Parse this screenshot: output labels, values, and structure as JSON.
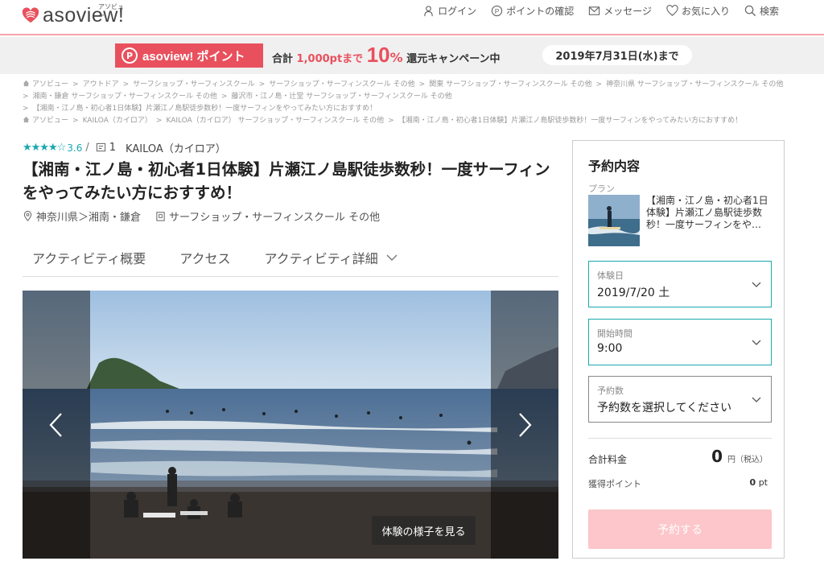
{
  "header": {
    "logo_text": "asoview!",
    "logo_sub": "アソビュー",
    "nav": [
      {
        "label": "ログイン"
      },
      {
        "label": "ポイントの確認"
      },
      {
        "label": "メッセージ"
      },
      {
        "label": "お気に入り"
      },
      {
        "label": "検索"
      }
    ]
  },
  "banner": {
    "badge_p": "P",
    "badge_name": "asoview! ポイント",
    "prefix": "合計",
    "amount": "1,000ptまで",
    "percent": "10",
    "percent_unit": "%",
    "suffix": "還元キャンペーン中",
    "date": "2019年7月31日(水)まで"
  },
  "breadcrumbs": {
    "line1": [
      "アソビュー",
      "アウトドア",
      "サーフショップ・サーフィンスクール",
      "サーフショップ・サーフィンスクール その他",
      "関東 サーフショップ・サーフィンスクール その他",
      "神奈川県 サーフショップ・サーフィンスクール その他"
    ],
    "line2": [
      "湘南・鎌倉 サーフショップ・サーフィンスクール その他",
      "藤沢市・江ノ島・辻堂 サーフショップ・サーフィンスクール その他"
    ],
    "line3": [
      "【湘南・江ノ島・初心者1日体験】片瀬江ノ島駅徒歩数秒！一度サーフィンをやってみたい方におすすめ！"
    ],
    "line4": [
      "アソビュー",
      "KAILOA（カイロア）",
      "KAILOA（カイロア） サーフショップ・サーフィンスクール その他",
      "【湘南・江ノ島・初心者1日体験】片瀬江ノ島駅徒歩数秒！一度サーフィンをやってみたい方におすすめ！"
    ]
  },
  "activity": {
    "stars": "★★★★☆",
    "score": "3.6",
    "slash": "/",
    "review_count": "1",
    "shop_name": "KAILOA（カイロア）",
    "title": "【湘南・江ノ島・初心者1日体験】片瀬江ノ島駅徒歩数秒！一度サーフィンをやってみたい方におすすめ！",
    "location": "神奈川県＞湘南・鎌倉",
    "category": "サーフショップ・サーフィンスクール その他",
    "rating_value": 3.6
  },
  "tabs": [
    {
      "label": "アクティビティ概要"
    },
    {
      "label": "アクセス"
    },
    {
      "label": "アクティビティ詳細"
    }
  ],
  "gallery": {
    "view_button": "体験の様子を見る"
  },
  "reservation": {
    "title": "予約内容",
    "plan_label": "プラン",
    "plan_name": "【湘南・江ノ島・初心者1日体験】片瀬江ノ島駅徒歩数秒！一度サーフィンをや…",
    "date_label": "体験日",
    "date_value": "2019/7/20 土",
    "time_label": "開始時間",
    "time_value": "9:00",
    "count_label": "予約数",
    "count_value": "予約数を選択してください",
    "total_label": "合計料金",
    "total_value": "0",
    "total_unit": "円（税込）",
    "points_label": "獲得ポイント",
    "points_value": "0",
    "points_unit": "pt",
    "reserve_button": "予約する"
  },
  "colors": {
    "brand": "#e9505d",
    "accent": "#1aa8b0",
    "button_disabled": "#fcc6ca"
  }
}
